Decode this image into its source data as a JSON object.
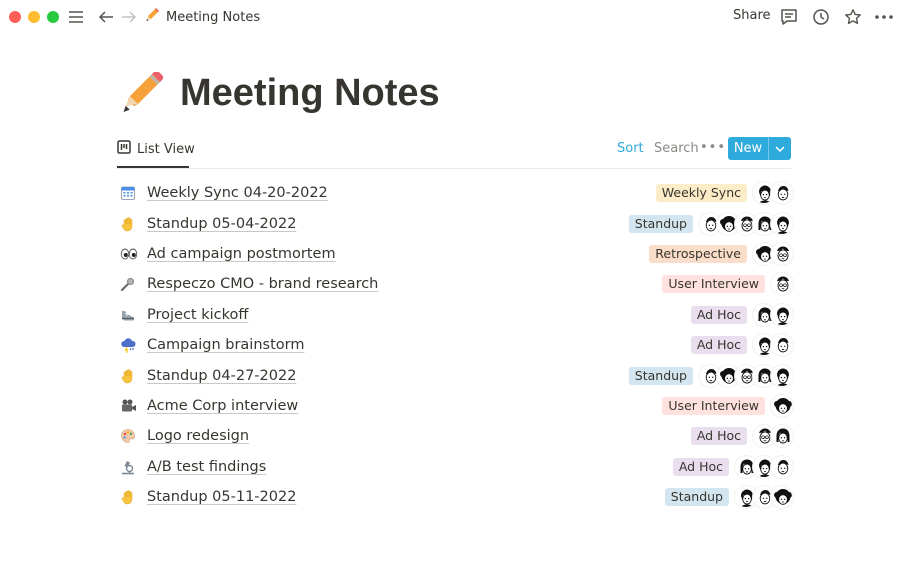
{
  "window": {
    "traffic_lights": [
      "#ff5f57",
      "#febc2e",
      "#28c840"
    ]
  },
  "topbar": {
    "breadcrumb_icon": "pencil-icon",
    "breadcrumb_title": "Meeting Notes",
    "share_label": "Share",
    "icons": [
      "menu-icon",
      "back-arrow-icon",
      "forward-arrow-icon",
      "comment-icon",
      "clock-icon",
      "star-icon",
      "more-icon"
    ]
  },
  "page": {
    "icon": "pencil-icon",
    "title": "Meeting Notes"
  },
  "view": {
    "tab_label": "List View",
    "tab_icon": "list-view-icon",
    "sort_label": "Sort",
    "search_label": "Search",
    "more_label": "•••",
    "new_label": "New",
    "accent": "#2eaadc"
  },
  "tag_colors": {
    "Weekly Sync": "#fdecc8",
    "Standup": "#d3e5ef",
    "Retrospective": "#fadec9",
    "User Interview": "#ffe2dd",
    "Ad Hoc": "#e8deee"
  },
  "rows": [
    {
      "icon": "calendar-icon",
      "title": "Weekly Sync 04-20-2022",
      "tag": "Weekly Sync",
      "avatars": 2
    },
    {
      "icon": "raised-hand-icon",
      "title": "Standup 05-04-2022",
      "tag": "Standup",
      "avatars": 5
    },
    {
      "icon": "eyes-icon",
      "title": "Ad campaign postmortem",
      "tag": "Retrospective",
      "avatars": 2
    },
    {
      "icon": "microphone-icon",
      "title": "Respeczo CMO - brand research",
      "tag": "User Interview",
      "avatars": 1
    },
    {
      "icon": "sneaker-icon",
      "title": "Project kickoff",
      "tag": "Ad Hoc",
      "avatars": 2
    },
    {
      "icon": "storm-cloud-icon",
      "title": "Campaign brainstorm",
      "tag": "Ad Hoc",
      "avatars": 2
    },
    {
      "icon": "raised-hand-icon",
      "title": "Standup 04-27-2022",
      "tag": "Standup",
      "avatars": 5
    },
    {
      "icon": "video-camera-icon",
      "title": "Acme Corp interview",
      "tag": "User Interview",
      "avatars": 1
    },
    {
      "icon": "palette-icon",
      "title": "Logo redesign",
      "tag": "Ad Hoc",
      "avatars": 2
    },
    {
      "icon": "microscope-icon",
      "title": "A/B test findings",
      "tag": "Ad Hoc",
      "avatars": 3
    },
    {
      "icon": "raised-hand-icon",
      "title": "Standup 05-11-2022",
      "tag": "Standup",
      "avatars": 3
    }
  ]
}
